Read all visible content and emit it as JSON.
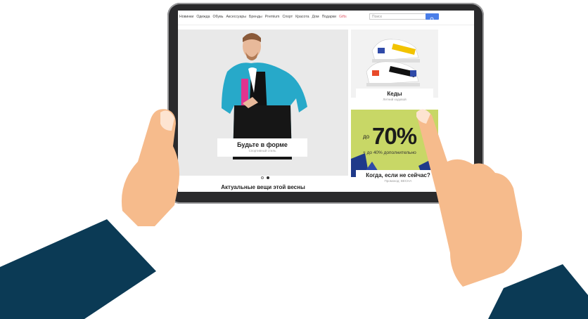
{
  "nav": {
    "items": [
      "Новинки",
      "Одежда",
      "Обувь",
      "Аксессуары",
      "Бренды",
      "Premium",
      "Спорт",
      "Красота",
      "Дом",
      "Подарки"
    ],
    "gifts": "Gifts"
  },
  "search": {
    "placeholder": "Поиск"
  },
  "hero": {
    "title": "Будьте в форме",
    "subtitle": "Спортивный стиль"
  },
  "carousel": {
    "slides": 2,
    "active_index": 1
  },
  "section": {
    "title": "Актуальные вещи этой весны"
  },
  "shoes": {
    "title": "Кеды",
    "subtitle": "Летний ходовой"
  },
  "promo": {
    "prefix": "до",
    "big": "70%",
    "sub": "+ до 40% дополнительно",
    "title": "Когда, если не сейчас?",
    "code": "Промокод: ВЕСНА"
  },
  "colors": {
    "accent": "#4a7ee8",
    "gifts": "#e05a6a",
    "promo_bg": "#c8d766",
    "sleeve": "#0b3a55",
    "skin": "#f6bb8c"
  }
}
